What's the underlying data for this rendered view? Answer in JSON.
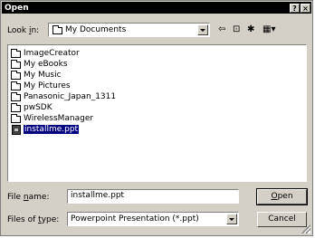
{
  "window": {
    "title": "Open",
    "help": "?",
    "close": "×"
  },
  "lookin": {
    "label_prefix": "Look ",
    "label_underlined": "i",
    "label_suffix": "n:",
    "value": "My Documents"
  },
  "toolbar": {
    "back": "⇦",
    "up": "⊡",
    "new_folder": "✱",
    "views": "▦▾"
  },
  "files": [
    {
      "name": "ImageCreator",
      "type": "folder"
    },
    {
      "name": "My eBooks",
      "type": "folder"
    },
    {
      "name": "My Music",
      "type": "folder"
    },
    {
      "name": "My Pictures",
      "type": "folder"
    },
    {
      "name": "Panasonic_Japan_1311",
      "type": "folder"
    },
    {
      "name": "pwSDK",
      "type": "folder"
    },
    {
      "name": "WirelessManager",
      "type": "folder"
    },
    {
      "name": "installme.ppt",
      "type": "file",
      "selected": true
    }
  ],
  "filename": {
    "label_prefix": "File ",
    "label_underlined": "n",
    "label_suffix": "ame:",
    "value": "installme.ppt"
  },
  "filetype": {
    "label_prefix": "Files of ",
    "label_underlined": "t",
    "label_suffix": "ype:",
    "value": "Powerpoint Presentation (*.ppt)"
  },
  "buttons": {
    "open_underlined": "O",
    "open_rest": "pen",
    "cancel": "Cancel"
  }
}
